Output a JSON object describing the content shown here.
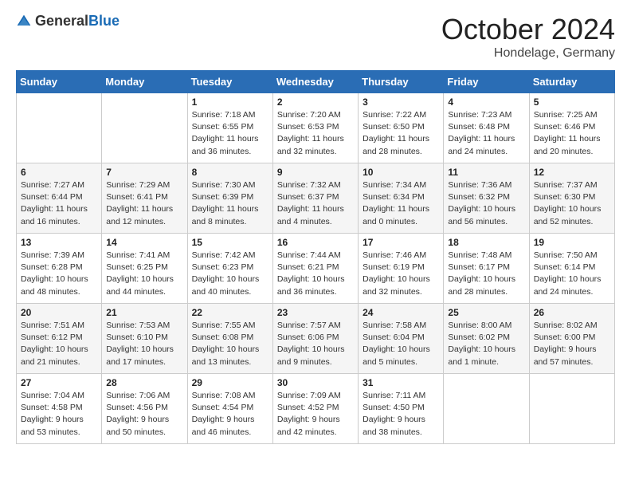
{
  "logo": {
    "general": "General",
    "blue": "Blue"
  },
  "header": {
    "month": "October 2024",
    "location": "Hondelage, Germany"
  },
  "weekdays": [
    "Sunday",
    "Monday",
    "Tuesday",
    "Wednesday",
    "Thursday",
    "Friday",
    "Saturday"
  ],
  "weeks": [
    [
      {
        "day": "",
        "info": ""
      },
      {
        "day": "",
        "info": ""
      },
      {
        "day": "1",
        "info": "Sunrise: 7:18 AM\nSunset: 6:55 PM\nDaylight: 11 hours and 36 minutes."
      },
      {
        "day": "2",
        "info": "Sunrise: 7:20 AM\nSunset: 6:53 PM\nDaylight: 11 hours and 32 minutes."
      },
      {
        "day": "3",
        "info": "Sunrise: 7:22 AM\nSunset: 6:50 PM\nDaylight: 11 hours and 28 minutes."
      },
      {
        "day": "4",
        "info": "Sunrise: 7:23 AM\nSunset: 6:48 PM\nDaylight: 11 hours and 24 minutes."
      },
      {
        "day": "5",
        "info": "Sunrise: 7:25 AM\nSunset: 6:46 PM\nDaylight: 11 hours and 20 minutes."
      }
    ],
    [
      {
        "day": "6",
        "info": "Sunrise: 7:27 AM\nSunset: 6:44 PM\nDaylight: 11 hours and 16 minutes."
      },
      {
        "day": "7",
        "info": "Sunrise: 7:29 AM\nSunset: 6:41 PM\nDaylight: 11 hours and 12 minutes."
      },
      {
        "day": "8",
        "info": "Sunrise: 7:30 AM\nSunset: 6:39 PM\nDaylight: 11 hours and 8 minutes."
      },
      {
        "day": "9",
        "info": "Sunrise: 7:32 AM\nSunset: 6:37 PM\nDaylight: 11 hours and 4 minutes."
      },
      {
        "day": "10",
        "info": "Sunrise: 7:34 AM\nSunset: 6:34 PM\nDaylight: 11 hours and 0 minutes."
      },
      {
        "day": "11",
        "info": "Sunrise: 7:36 AM\nSunset: 6:32 PM\nDaylight: 10 hours and 56 minutes."
      },
      {
        "day": "12",
        "info": "Sunrise: 7:37 AM\nSunset: 6:30 PM\nDaylight: 10 hours and 52 minutes."
      }
    ],
    [
      {
        "day": "13",
        "info": "Sunrise: 7:39 AM\nSunset: 6:28 PM\nDaylight: 10 hours and 48 minutes."
      },
      {
        "day": "14",
        "info": "Sunrise: 7:41 AM\nSunset: 6:25 PM\nDaylight: 10 hours and 44 minutes."
      },
      {
        "day": "15",
        "info": "Sunrise: 7:42 AM\nSunset: 6:23 PM\nDaylight: 10 hours and 40 minutes."
      },
      {
        "day": "16",
        "info": "Sunrise: 7:44 AM\nSunset: 6:21 PM\nDaylight: 10 hours and 36 minutes."
      },
      {
        "day": "17",
        "info": "Sunrise: 7:46 AM\nSunset: 6:19 PM\nDaylight: 10 hours and 32 minutes."
      },
      {
        "day": "18",
        "info": "Sunrise: 7:48 AM\nSunset: 6:17 PM\nDaylight: 10 hours and 28 minutes."
      },
      {
        "day": "19",
        "info": "Sunrise: 7:50 AM\nSunset: 6:14 PM\nDaylight: 10 hours and 24 minutes."
      }
    ],
    [
      {
        "day": "20",
        "info": "Sunrise: 7:51 AM\nSunset: 6:12 PM\nDaylight: 10 hours and 21 minutes."
      },
      {
        "day": "21",
        "info": "Sunrise: 7:53 AM\nSunset: 6:10 PM\nDaylight: 10 hours and 17 minutes."
      },
      {
        "day": "22",
        "info": "Sunrise: 7:55 AM\nSunset: 6:08 PM\nDaylight: 10 hours and 13 minutes."
      },
      {
        "day": "23",
        "info": "Sunrise: 7:57 AM\nSunset: 6:06 PM\nDaylight: 10 hours and 9 minutes."
      },
      {
        "day": "24",
        "info": "Sunrise: 7:58 AM\nSunset: 6:04 PM\nDaylight: 10 hours and 5 minutes."
      },
      {
        "day": "25",
        "info": "Sunrise: 8:00 AM\nSunset: 6:02 PM\nDaylight: 10 hours and 1 minute."
      },
      {
        "day": "26",
        "info": "Sunrise: 8:02 AM\nSunset: 6:00 PM\nDaylight: 9 hours and 57 minutes."
      }
    ],
    [
      {
        "day": "27",
        "info": "Sunrise: 7:04 AM\nSunset: 4:58 PM\nDaylight: 9 hours and 53 minutes."
      },
      {
        "day": "28",
        "info": "Sunrise: 7:06 AM\nSunset: 4:56 PM\nDaylight: 9 hours and 50 minutes."
      },
      {
        "day": "29",
        "info": "Sunrise: 7:08 AM\nSunset: 4:54 PM\nDaylight: 9 hours and 46 minutes."
      },
      {
        "day": "30",
        "info": "Sunrise: 7:09 AM\nSunset: 4:52 PM\nDaylight: 9 hours and 42 minutes."
      },
      {
        "day": "31",
        "info": "Sunrise: 7:11 AM\nSunset: 4:50 PM\nDaylight: 9 hours and 38 minutes."
      },
      {
        "day": "",
        "info": ""
      },
      {
        "day": "",
        "info": ""
      }
    ]
  ]
}
